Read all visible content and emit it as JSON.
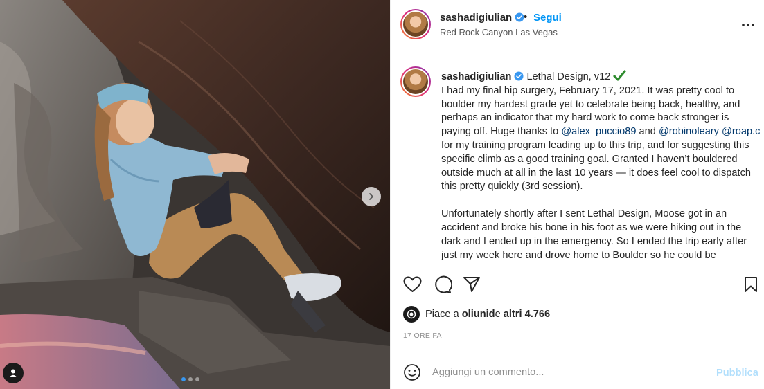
{
  "post": {
    "username": "sashadigiulian",
    "follow_label": "Segui",
    "separator": "•",
    "location": "Red Rock Canyon Las Vegas",
    "more_icon": "more-horizontal-icon"
  },
  "caption": {
    "username": "sashadigiulian",
    "title": "Lethal Design, v12",
    "t1": "I had my final hip surgery, February 17, 2021. It was pretty cool to boulder my hardest grade yet to celebrate being back, healthy, and perhaps an indicator that my hard work to come back stronger is paying off. Huge thanks to ",
    "m1": "@alex_puccio89",
    "t2": " and ",
    "m2": "@robinoleary",
    "t3": " ",
    "m3": "@roap.c",
    "t4": " for my training program leading up to this trip, and for suggesting this specific climb as a good training goal. Granted I haven’t bouldered outside much at all in the last 10 years — it does feel cool to dispatch this pretty quickly (3rd session).",
    "p2": "Unfortunately shortly after I sent Lethal Design, Moose got in an accident and broke his bone in his foot as we were hiking out in the dark and I ended up in the emergency. So I ended the trip early after just my week here and drove home to Boulder so he could be"
  },
  "actions": {
    "like_icon": "heart-icon",
    "comment_icon": "comment-icon",
    "share_icon": "send-icon",
    "save_icon": "bookmark-icon"
  },
  "likes": {
    "prefix": "Piace a ",
    "user": "oliunid",
    "middle": " e ",
    "others": "altri 4.766"
  },
  "timestamp": "17 ORE FA",
  "comment": {
    "placeholder": "Aggiungi un commento...",
    "publish_label": "Pubblica",
    "emoji_icon": "emoji-icon"
  },
  "carousel": {
    "slide_count": 3,
    "active_index": 0,
    "next_icon": "chevron-right-icon",
    "tag_icon": "user-tag-icon"
  },
  "colors": {
    "accent": "#0095f6",
    "verified": "#3897f0",
    "checkmark": "#2e8b2e",
    "mention": "#00376b",
    "publish_disabled": "#b2dffc"
  }
}
